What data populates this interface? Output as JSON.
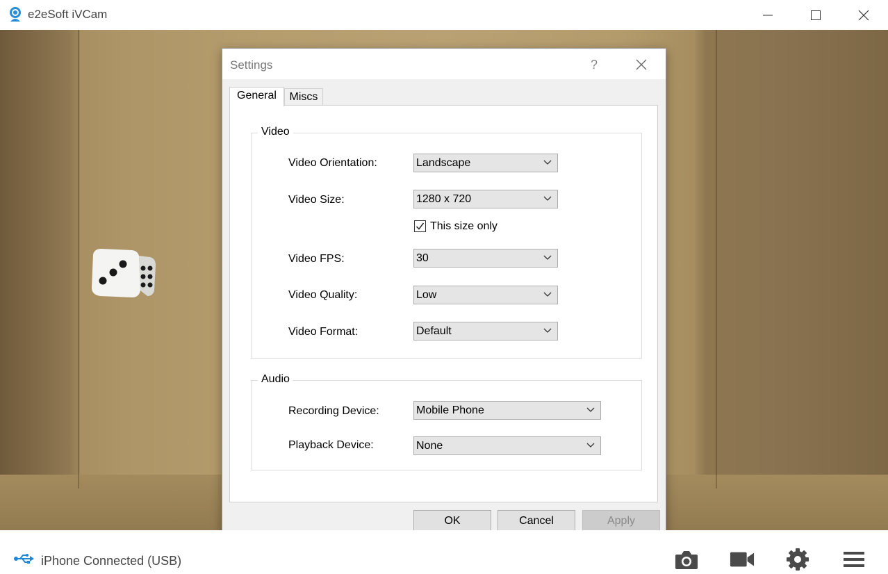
{
  "window": {
    "title": "e2eSoft iVCam"
  },
  "dialog": {
    "title": "Settings",
    "help_label": "?",
    "tabs": [
      {
        "label": "General"
      },
      {
        "label": "Miscs"
      }
    ],
    "video_group": {
      "title": "Video",
      "orientation": {
        "label": "Video Orientation:",
        "value": "Landscape"
      },
      "size": {
        "label": "Video Size:",
        "value": "1280 x 720"
      },
      "size_only": {
        "label": "This size only",
        "checked": true
      },
      "fps": {
        "label": "Video FPS:",
        "value": "30"
      },
      "quality": {
        "label": "Video Quality:",
        "value": "Low"
      },
      "format": {
        "label": "Video Format:",
        "value": "Default"
      }
    },
    "audio_group": {
      "title": "Audio",
      "recording": {
        "label": "Recording Device:",
        "value": "Mobile Phone"
      },
      "playback": {
        "label": "Playback Device:",
        "value": "None"
      }
    },
    "buttons": {
      "ok": "OK",
      "cancel": "Cancel",
      "apply": "Apply"
    }
  },
  "status": {
    "connection_text": "iPhone Connected (USB)",
    "accent_color": "#1e88d8"
  },
  "toolbar_icons": [
    "camera-icon",
    "video-camera-icon",
    "gear-icon",
    "hamburger-menu-icon"
  ]
}
